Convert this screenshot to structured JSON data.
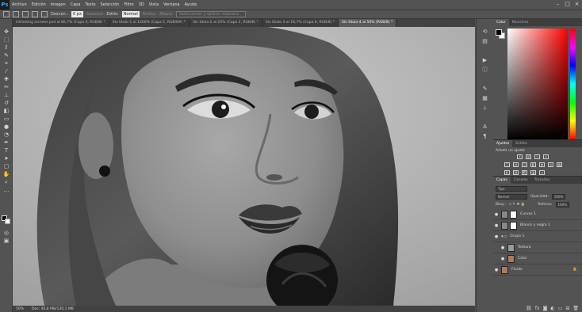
{
  "app": {
    "logo": "Ps"
  },
  "menu": [
    "Archivo",
    "Edición",
    "Imagen",
    "Capa",
    "Texto",
    "Selección",
    "Filtro",
    "3D",
    "Vista",
    "Ventana",
    "Ayuda"
  ],
  "options": {
    "feather_label": "Desvan.:",
    "feather_value": "0 px",
    "antialias_label": "Suavizar",
    "style_label": "Estilo:",
    "style_value": "Normal",
    "width_label": "Anchu:",
    "height_label": "Altura:",
    "refine_button": "Seleccionar y aplicar máscara..."
  },
  "tabs": [
    {
      "label": "lnthreting screens psd al 66,7% (Capa 4, RGB/8) *",
      "active": false
    },
    {
      "label": "Sin título-1 al 1200% (Capa 5, RGB/8#) *",
      "active": false
    },
    {
      "label": "Sin título-2 al 25% (Capa 2, RGB/8) *",
      "active": false
    },
    {
      "label": "Sin título-3 al 16,7% (Capa 6, RGB/8) *",
      "active": false
    },
    {
      "label": "Sin título-4 al 50% (RGB/8) *",
      "active": true
    }
  ],
  "status": {
    "zoom": "50%",
    "doc": "Doc: 40,8 MB/130,1 MB"
  },
  "panels": {
    "color_tabs": [
      "Color",
      "Muestras"
    ],
    "adjust_tabs": [
      "Ajustes",
      "Estilos"
    ],
    "adjust_title": "Añadir un ajuste",
    "layers_tabs": [
      "Capas",
      "Canales",
      "Trazados"
    ],
    "filter_label": "Tipo",
    "blend_mode": "Normal",
    "opacity_label": "Opacidad:",
    "opacity_value": "100%",
    "lock_label": "Bloq.:",
    "fill_label": "Relleno:",
    "fill_value": "100%"
  },
  "layers": [
    {
      "name": "Curvas 1",
      "type": "adjustment",
      "selected": false
    },
    {
      "name": "Blanco y negro 1",
      "type": "adjustment",
      "selected": false
    },
    {
      "name": "Grupo 1",
      "type": "group",
      "selected": false
    },
    {
      "name": "Textura",
      "type": "layer",
      "selected": false
    },
    {
      "name": "Color",
      "type": "layer",
      "selected": false
    },
    {
      "name": "Fondo",
      "type": "background",
      "selected": false
    }
  ],
  "colors": {
    "accent": "#31a8ff",
    "fg": "#000000",
    "bg": "#ffffff"
  }
}
